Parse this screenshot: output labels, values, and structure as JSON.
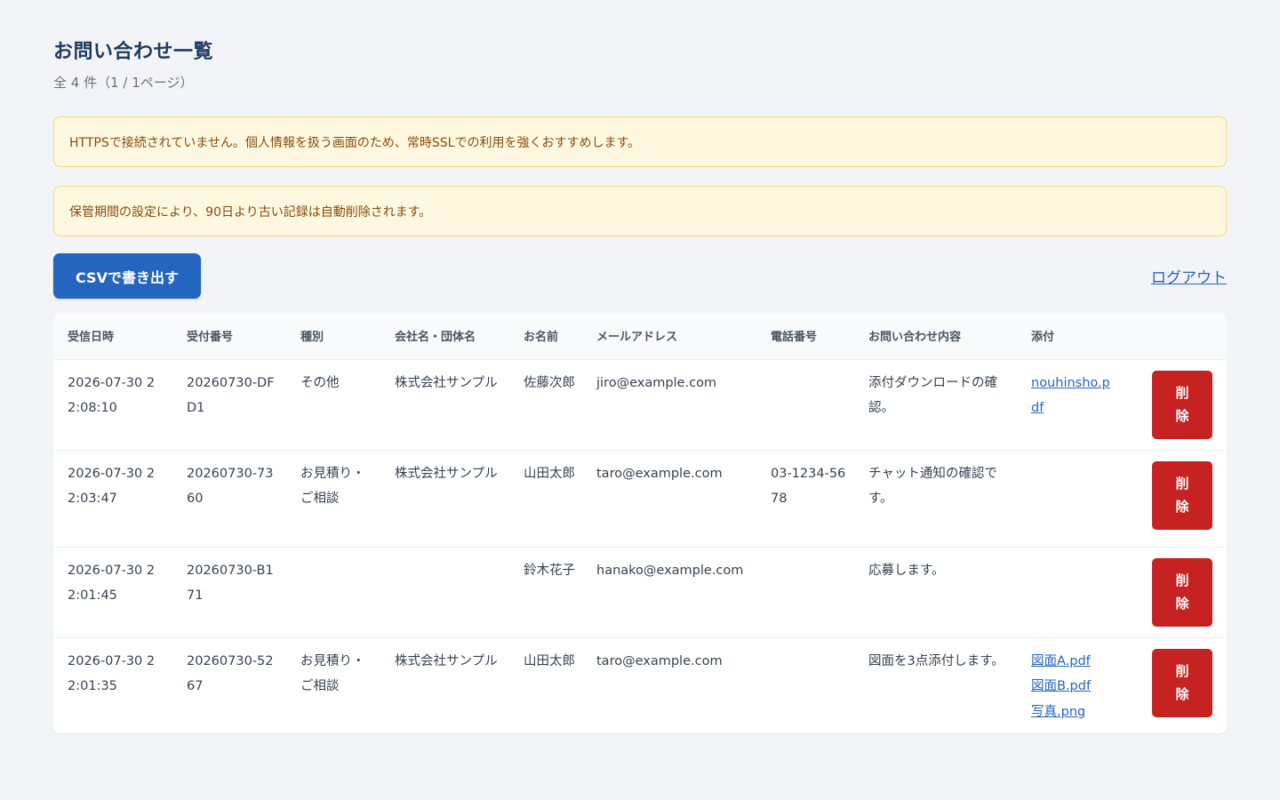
{
  "page": {
    "title": "お問い合わせ一覧",
    "count_text": "全 4 件（1 / 1ページ）"
  },
  "alerts": {
    "https": "HTTPSで接続されていません。個人情報を扱う画面のため、常時SSLでの利用を強くおすすめします。",
    "retention": "保管期間の設定により、90日より古い記録は自動削除されます。"
  },
  "toolbar": {
    "csv_label": "CSVで書き出す",
    "logout_label": "ログアウト"
  },
  "table": {
    "headers": [
      "受信日時",
      "受付番号",
      "種別",
      "会社名・団体名",
      "お名前",
      "メールアドレス",
      "電話番号",
      "お問い合わせ内容",
      "添付"
    ],
    "delete_label": "削除",
    "rows": [
      {
        "date": "2026-07-30 22:08:10",
        "receipt": "20260730-DFD1",
        "type": "その他",
        "company": "株式会社サンプル",
        "name": "佐藤次郎",
        "email": "jiro@example.com",
        "phone": "",
        "message": "添付ダウンロードの確認。",
        "attachments": [
          "nouhinsho.pdf"
        ]
      },
      {
        "date": "2026-07-30 22:03:47",
        "receipt": "20260730-7360",
        "type": "お見積り・ご相談",
        "company": "株式会社サンプル",
        "name": "山田太郎",
        "email": "taro@example.com",
        "phone": "03-1234-5678",
        "message": "チャット通知の確認です。",
        "attachments": []
      },
      {
        "date": "2026-07-30 22:01:45",
        "receipt": "20260730-B171",
        "type": "",
        "company": "",
        "name": "鈴木花子",
        "email": "hanako@example.com",
        "phone": "",
        "message": "応募します。",
        "attachments": []
      },
      {
        "date": "2026-07-30 22:01:35",
        "receipt": "20260730-5267",
        "type": "お見積り・ご相談",
        "company": "株式会社サンプル",
        "name": "山田太郎",
        "email": "taro@example.com",
        "phone": "",
        "message": "図面を3点添付します。",
        "attachments": [
          "図面A.pdf",
          "図面B.pdf",
          "写真.png"
        ]
      }
    ]
  },
  "colors": {
    "primary": "#2465c0",
    "danger": "#c62222",
    "alert_bg": "#fff8e1",
    "alert_text": "#8a4a0a",
    "title": "#1e3a5f"
  }
}
